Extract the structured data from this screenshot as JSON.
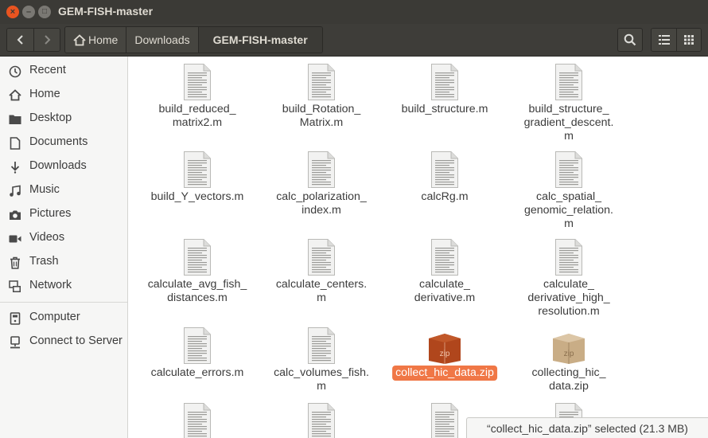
{
  "window": {
    "title": "GEM-FISH-master",
    "close_glyph": "×",
    "min_glyph": "–",
    "max_glyph": "□"
  },
  "breadcrumbs": {
    "home": "Home",
    "downloads": "Downloads",
    "current": "GEM-FISH-master"
  },
  "sidebar": {
    "items": [
      {
        "label": "Recent",
        "icon": "clock-icon"
      },
      {
        "label": "Home",
        "icon": "home-icon"
      },
      {
        "label": "Desktop",
        "icon": "folder-icon"
      },
      {
        "label": "Documents",
        "icon": "document-icon"
      },
      {
        "label": "Downloads",
        "icon": "download-icon"
      },
      {
        "label": "Music",
        "icon": "music-icon"
      },
      {
        "label": "Pictures",
        "icon": "camera-icon"
      },
      {
        "label": "Videos",
        "icon": "video-icon"
      },
      {
        "label": "Trash",
        "icon": "trash-icon"
      },
      {
        "label": "Network",
        "icon": "network-icon"
      },
      {
        "label": "Computer",
        "icon": "computer-icon"
      },
      {
        "label": "Connect to Server",
        "icon": "server-icon"
      }
    ]
  },
  "files": [
    {
      "name": "build_reduced_\nmatrix2.m",
      "type": "text"
    },
    {
      "name": "build_Rotation_\nMatrix.m",
      "type": "text"
    },
    {
      "name": "build_structure.m",
      "type": "text"
    },
    {
      "name": "build_structure_\ngradient_descent.\nm",
      "type": "text"
    },
    {
      "name": "build_Y_vectors.m",
      "type": "text"
    },
    {
      "name": "calc_polarization_\nindex.m",
      "type": "text"
    },
    {
      "name": "calcRg.m",
      "type": "text"
    },
    {
      "name": "calc_spatial_\ngenomic_relation.\nm",
      "type": "text"
    },
    {
      "name": "calculate_avg_fish_\ndistances.m",
      "type": "text"
    },
    {
      "name": "calculate_centers.\nm",
      "type": "text"
    },
    {
      "name": "calculate_\nderivative.m",
      "type": "text"
    },
    {
      "name": "calculate_\nderivative_high_\nresolution.m",
      "type": "text"
    },
    {
      "name": "calculate_errors.m",
      "type": "text"
    },
    {
      "name": "calc_volumes_fish.\nm",
      "type": "text"
    },
    {
      "name": "collect_hic_data.zip",
      "type": "zip-selected",
      "badge": "zip"
    },
    {
      "name": "collecting_hic_\ndata.zip",
      "type": "zip",
      "badge": "zip"
    },
    {
      "name": "",
      "type": "text"
    },
    {
      "name": "",
      "type": "text"
    },
    {
      "name": "",
      "type": "text"
    },
    {
      "name": "",
      "type": "text"
    }
  ],
  "status": "“collect_hic_data.zip” selected  (21.3 MB)",
  "colors": {
    "accent": "#f07746",
    "titlebar": "#3b3a36",
    "close_button": "#e95420"
  }
}
